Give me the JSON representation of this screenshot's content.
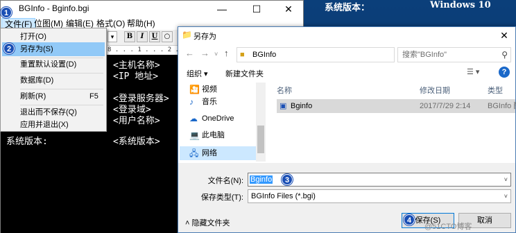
{
  "desktop": {
    "label": "系统版本：",
    "value": "Windows 10"
  },
  "bginfo": {
    "title": "BGInfo - Bginfo.bgi",
    "menus": [
      "文件(F)",
      "位图(M)",
      "编辑(E)",
      "格式(O)",
      "帮助(H)"
    ],
    "toolbar": {
      "bold": "B",
      "italic": "I",
      "underline": "U"
    },
    "ruler": "8 . . . 1 . . . 2 . . . 3 . . .",
    "editor_lines": [
      "<主机名称>",
      "<IP 地址>",
      "<登录服务器>",
      "<登录域>",
      "<用户名称>",
      "<系统版本>"
    ],
    "editor_label": "系统版本:"
  },
  "file_menu": {
    "items": [
      {
        "label": "打开(O)",
        "shortcut": ""
      },
      {
        "label": "另存为(S)",
        "shortcut": ""
      },
      {
        "label": "重置默认设置(D)",
        "shortcut": ""
      },
      {
        "label": "数据库(D)",
        "shortcut": ""
      },
      {
        "label": "刷新(R)",
        "shortcut": "F5"
      },
      {
        "label": "退出而不保存(Q)",
        "shortcut": ""
      },
      {
        "label": "应用并退出(X)",
        "shortcut": ""
      }
    ]
  },
  "dialog": {
    "title": "另存为",
    "address": "BGInfo",
    "search_placeholder": "搜索\"BGInfo\"",
    "organize": "组织 ▾",
    "new_folder": "新建文件夹",
    "nav_items": [
      "视频",
      "音乐",
      "OneDrive",
      "此电脑",
      "网络"
    ],
    "columns": [
      "名称",
      "修改日期",
      "类型"
    ],
    "file": {
      "name": "Bginfo",
      "date": "2017/7/29 2:14",
      "type": "BGInfo 配"
    },
    "filename_label": "文件名(N):",
    "filename_value": "Bginfo",
    "filetype_label": "保存类型(T):",
    "filetype_value": "BGInfo Files (*.bgi)",
    "hide_folders": "隐藏文件夹",
    "save": "保存(S)",
    "cancel": "取消"
  },
  "steps": [
    "1",
    "2",
    "3",
    "4"
  ],
  "watermark": "@51CTO博客"
}
